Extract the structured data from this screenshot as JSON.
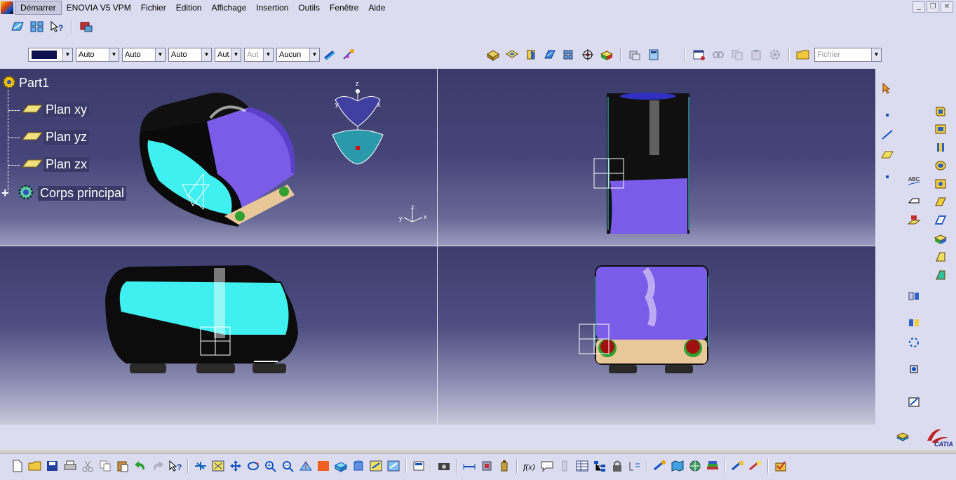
{
  "menubar": {
    "start": "Démarrer",
    "items": [
      "ENOVIA V5 VPM",
      "Fichier",
      "Edition",
      "Affichage",
      "Insertion",
      "Outils",
      "Fenêtre",
      "Aide"
    ]
  },
  "graphic_props": {
    "color_value": "",
    "line_type": "Auto",
    "line_thickness": "Auto",
    "point_symbol": "Auto",
    "render_style": "Aut",
    "layer_disabled": "Aut",
    "layer": "Aucun"
  },
  "file_combo": "Fichier",
  "tree": {
    "root": "Part1",
    "items": [
      "Plan xy",
      "Plan yz",
      "Plan zx"
    ],
    "body": "Corps principal"
  },
  "compass": {
    "z": "z",
    "x": "x",
    "y": "y"
  },
  "axis_triad": {
    "x": "x",
    "y": "y",
    "z": "z"
  },
  "colors": {
    "menu_bg": "#dcdcf0",
    "viewport_top": "#3c3c6e",
    "viewport_bottom": "#bcbcd8",
    "part_purple": "#7b5ce8",
    "part_cyan": "#40f0f0",
    "part_black": "#101010",
    "part_tan": "#e8c898"
  },
  "icons": {
    "top_row": [
      "sketch-icon",
      "multi-view-icon",
      "help-icon",
      "catalog-icon"
    ],
    "bottom_row": [
      "new-icon",
      "open-icon",
      "save-icon",
      "print-icon",
      "cut-icon",
      "copy-icon",
      "paste-icon",
      "undo-icon",
      "redo-icon",
      "whats-this-icon",
      "fly-mode-icon",
      "fit-all-icon",
      "pan-icon",
      "rotate-icon",
      "zoom-in-icon",
      "zoom-out-icon",
      "normal-view-icon",
      "iso-view-icon",
      "view-mode-icon",
      "hide-show-icon",
      "swap-icon",
      "render-icon",
      "measure-icon",
      "inertia-icon",
      "formula-icon",
      "comment-icon",
      "table-icon",
      "tree-icon",
      "lock-icon",
      "ok-icon"
    ]
  },
  "brand": "CATIA"
}
